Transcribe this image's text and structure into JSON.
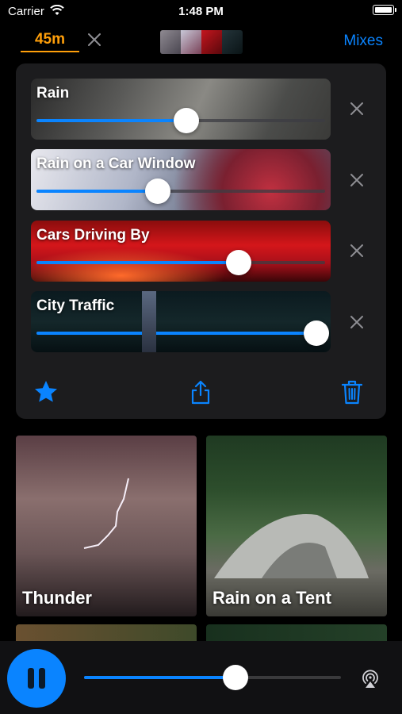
{
  "status": {
    "carrier": "Carrier",
    "time": "1:48 PM"
  },
  "toolbar": {
    "timer": "45m",
    "mixes_label": "Mixes"
  },
  "mix": {
    "tracks": [
      {
        "name": "Rain",
        "volume": 0.52
      },
      {
        "name": "Rain on a Car Window",
        "volume": 0.42
      },
      {
        "name": "Cars Driving By",
        "volume": 0.7
      },
      {
        "name": "City Traffic",
        "volume": 0.97
      }
    ]
  },
  "sounds": [
    {
      "name": "Thunder"
    },
    {
      "name": "Rain on a Tent"
    }
  ],
  "player": {
    "master_volume": 0.59
  },
  "colors": {
    "accent": "#0a84ff",
    "timer": "#ff9f0a",
    "panel": "#1c1c1e"
  },
  "icons": [
    "wifi-icon",
    "battery-icon",
    "close-icon",
    "star-icon",
    "share-icon",
    "trash-icon",
    "pause-icon",
    "airplay-icon"
  ]
}
